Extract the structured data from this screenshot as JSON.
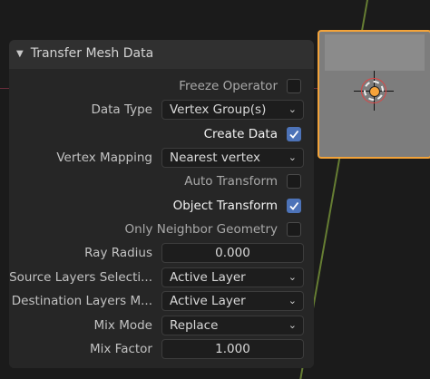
{
  "panel": {
    "title": "Transfer Mesh Data",
    "freeze_operator": {
      "label": "Freeze Operator",
      "checked": false
    },
    "data_type": {
      "label": "Data Type",
      "value": "Vertex Group(s)"
    },
    "create_data": {
      "label": "Create Data",
      "checked": true
    },
    "vertex_mapping": {
      "label": "Vertex Mapping",
      "value": "Nearest vertex"
    },
    "auto_transform": {
      "label": "Auto Transform",
      "checked": false
    },
    "object_transform": {
      "label": "Object Transform",
      "checked": true
    },
    "only_neighbor_geometry": {
      "label": "Only Neighbor Geometry",
      "checked": false
    },
    "ray_radius": {
      "label": "Ray Radius",
      "value": "0.000"
    },
    "source_layers": {
      "label": "Source Layers Selecti...",
      "value": "Active Layer"
    },
    "destination_layers": {
      "label": "Destination Layers M...",
      "value": "Active Layer"
    },
    "mix_mode": {
      "label": "Mix Mode",
      "value": "Replace"
    },
    "mix_factor": {
      "label": "Mix Factor",
      "value": "1.000"
    }
  },
  "colors": {
    "accent": "#4d73b8",
    "selection_outline": "#f3a33a",
    "x_axis": "#8a3448",
    "y_axis": "#6f8a36"
  }
}
